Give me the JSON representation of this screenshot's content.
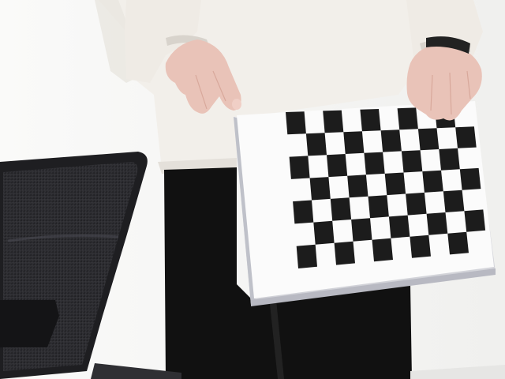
{
  "scene": {
    "subject": "person-holding-checkerboard",
    "calibration_board": {
      "rows": 7,
      "cols": 10,
      "square_color": "#1c1c1c",
      "board_color": "#fbfbfb"
    },
    "colors": {
      "background": "#f4f4f2",
      "sweater": "#f1eee8",
      "pants": "#101010",
      "chair": "#2a2a2a",
      "skin": "#e9c3b8"
    }
  }
}
